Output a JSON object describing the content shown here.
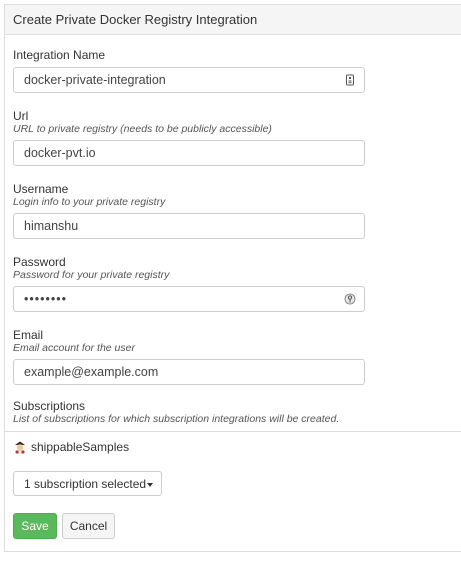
{
  "panel": {
    "title": "Create Private Docker Registry Integration"
  },
  "fields": {
    "integration_name": {
      "label": "Integration Name",
      "value": "docker-private-integration",
      "icon": "contact-card-icon"
    },
    "url": {
      "label": "Url",
      "help": "URL to private registry (needs to be publicly accessible)",
      "value": "docker-pvt.io"
    },
    "username": {
      "label": "Username",
      "help": "Login info to your private registry",
      "value": "himanshu"
    },
    "password": {
      "label": "Password",
      "help": "Password for your private registry",
      "value": "••••••••",
      "icon": "key-icon"
    },
    "email": {
      "label": "Email",
      "help": "Email account for the user",
      "value": "example@example.com"
    }
  },
  "subscriptions": {
    "label": "Subscriptions",
    "help": "List of subscriptions for which subscription integrations will be created.",
    "items": [
      {
        "name": "shippableSamples"
      }
    ],
    "dropdown_label": "1 subscription selected"
  },
  "actions": {
    "save_label": "Save",
    "cancel_label": "Cancel"
  },
  "colors": {
    "save": "#5cb85c",
    "heading_bg": "#f5f5f5",
    "border": "#dddddd"
  }
}
